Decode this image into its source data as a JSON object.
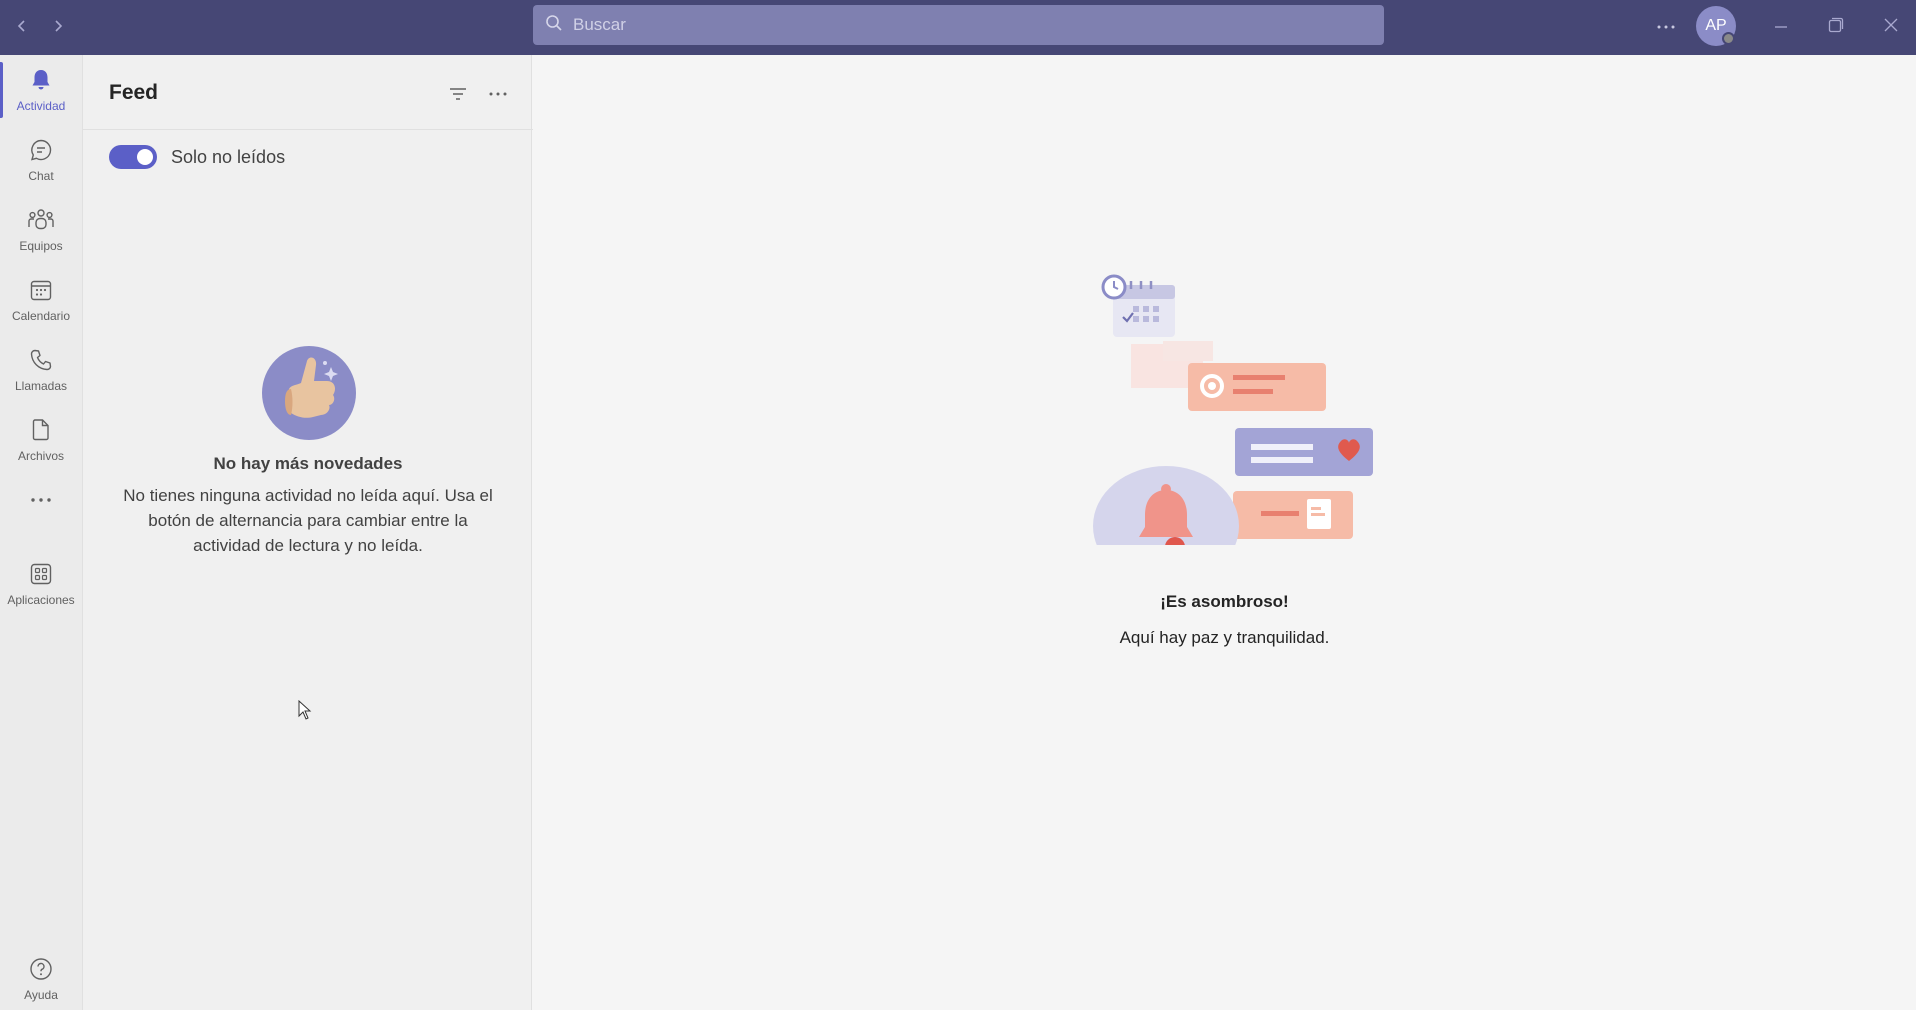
{
  "titlebar": {
    "search_placeholder": "Buscar",
    "avatar_initials": "AP",
    "more_icon": "ellipsis-icon",
    "window_controls": [
      "minimize-icon",
      "restore-icon",
      "close-icon"
    ]
  },
  "rail": {
    "items": [
      {
        "label": "Actividad",
        "icon": "bell-icon",
        "active": true
      },
      {
        "label": "Chat",
        "icon": "chat-icon"
      },
      {
        "label": "Equipos",
        "icon": "teams-icon"
      },
      {
        "label": "Calendario",
        "icon": "calendar-icon"
      },
      {
        "label": "Llamadas",
        "icon": "phone-icon"
      },
      {
        "label": "Archivos",
        "icon": "file-icon"
      },
      {
        "label": "Aplicaciones",
        "icon": "apps-icon"
      },
      {
        "label": "Ayuda",
        "icon": "help-icon"
      }
    ]
  },
  "feed": {
    "title": "Feed",
    "toggle_label": "Solo no leídos",
    "toggle_on": true,
    "empty_title": "No hay más novedades",
    "empty_text": "No tienes ninguna actividad no leída aquí. Usa el botón de alternancia para cambiar entre la actividad de lectura y no leída."
  },
  "main": {
    "title": "¡Es asombroso!",
    "text": "Aquí hay paz y tranquilidad."
  },
  "colors": {
    "titlebar": "#464775",
    "accent": "#5b5fc7",
    "search": "#7f80b0"
  }
}
